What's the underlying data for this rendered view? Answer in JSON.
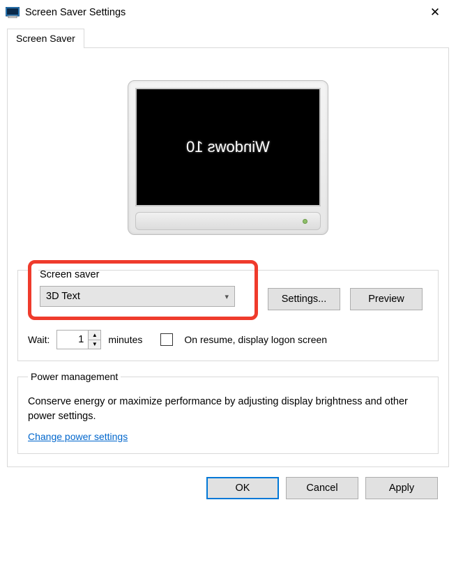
{
  "window": {
    "title": "Screen Saver Settings"
  },
  "tab": {
    "label": "Screen Saver"
  },
  "preview_screen_text": "Windows 10",
  "screensaver": {
    "group_label": "Screen saver",
    "selected": "3D Text",
    "settings_button": "Settings...",
    "preview_button": "Preview",
    "wait_label": "Wait:",
    "wait_value": "1",
    "minutes_label": "minutes",
    "resume_label": "On resume, display logon screen"
  },
  "power": {
    "group_label": "Power management",
    "text": "Conserve energy or maximize performance by adjusting display brightness and other power settings.",
    "link": "Change power settings"
  },
  "footer": {
    "ok": "OK",
    "cancel": "Cancel",
    "apply": "Apply"
  }
}
